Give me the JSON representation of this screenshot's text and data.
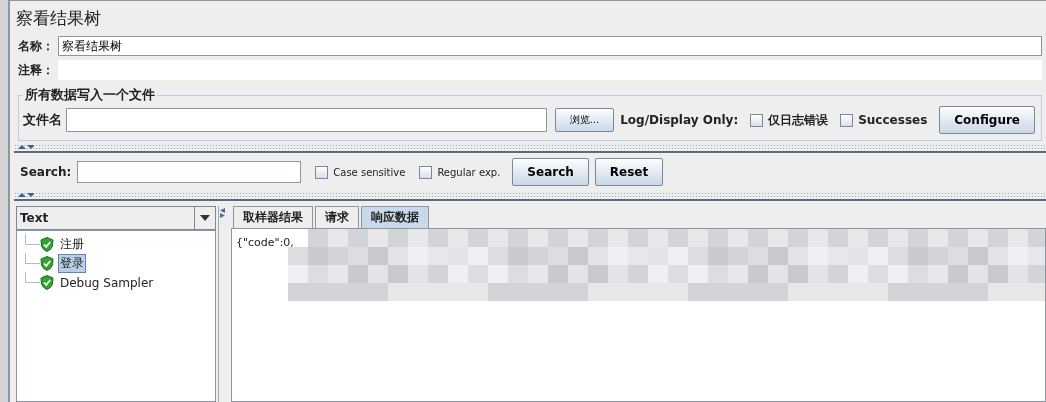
{
  "title": "察看结果树",
  "name_field": {
    "label": "名称：",
    "value": "察看结果树"
  },
  "comment_field": {
    "label": "注释："
  },
  "file_group": {
    "title": "所有数据写入一个文件",
    "label": "文件名",
    "browse": "浏览...",
    "log_label": "Log/Display Only:",
    "options": [
      {
        "label": "仅日志错误",
        "checked": false
      },
      {
        "label": "Successes",
        "checked": false
      }
    ],
    "configure": "Configure"
  },
  "search": {
    "label": "Search:",
    "options": [
      {
        "label": "Case sensitive",
        "checked": false
      },
      {
        "label": "Regular exp.",
        "checked": false
      }
    ],
    "buttons": [
      "Search",
      "Reset"
    ]
  },
  "renderer": "Text",
  "tree": [
    {
      "label": "注册",
      "selected": false
    },
    {
      "label": "登录",
      "selected": true
    },
    {
      "label": "Debug Sampler",
      "selected": false
    }
  ],
  "tabs": [
    {
      "label": "取样器结果",
      "selected": false
    },
    {
      "label": "请求",
      "selected": false
    },
    {
      "label": "响应数据",
      "selected": true
    }
  ],
  "response_text": "{\"code\":0,"
}
